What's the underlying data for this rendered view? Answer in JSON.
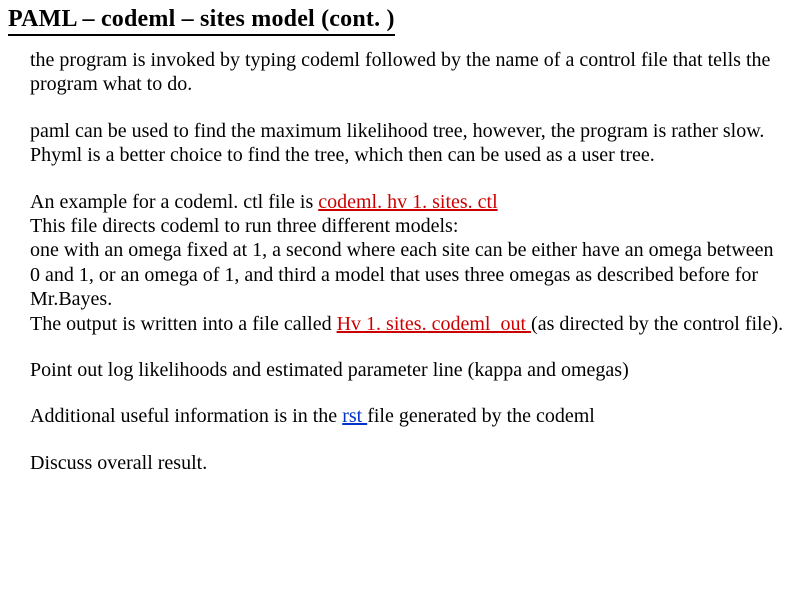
{
  "title": "PAML – codeml – sites model (cont. )",
  "para1": "the program is invoked by typing codeml followed by the name of a control file that tells the program what to do.",
  "para2": "paml can be used to find the maximum likelihood tree, however, the program is rather slow.  Phyml  is a better choice to find the tree, which then can be used as a user tree.",
  "p3a": "An example for a codeml. ctl file is ",
  "link1": "codeml. hv 1. sites. ctl",
  "p3b": "This file directs codeml to run three different models:",
  "p3c": "one with an omega fixed at 1, a second where each site can be either have an omega between 0 and 1, or an omega of 1, and third a model that uses three omegas as described before for Mr.Bayes.",
  "p3d": "The output is written into a file called ",
  "link2": "Hv 1. sites. codeml_out ",
  "p3e": "(as directed by the control file).",
  "para4": "Point out log likelihoods and estimated parameter line (kappa and omegas)",
  "p5a": "Additional useful information is in the ",
  "link3": "rst ",
  "p5b": "file generated by the codeml",
  "para6": "Discuss overall result."
}
